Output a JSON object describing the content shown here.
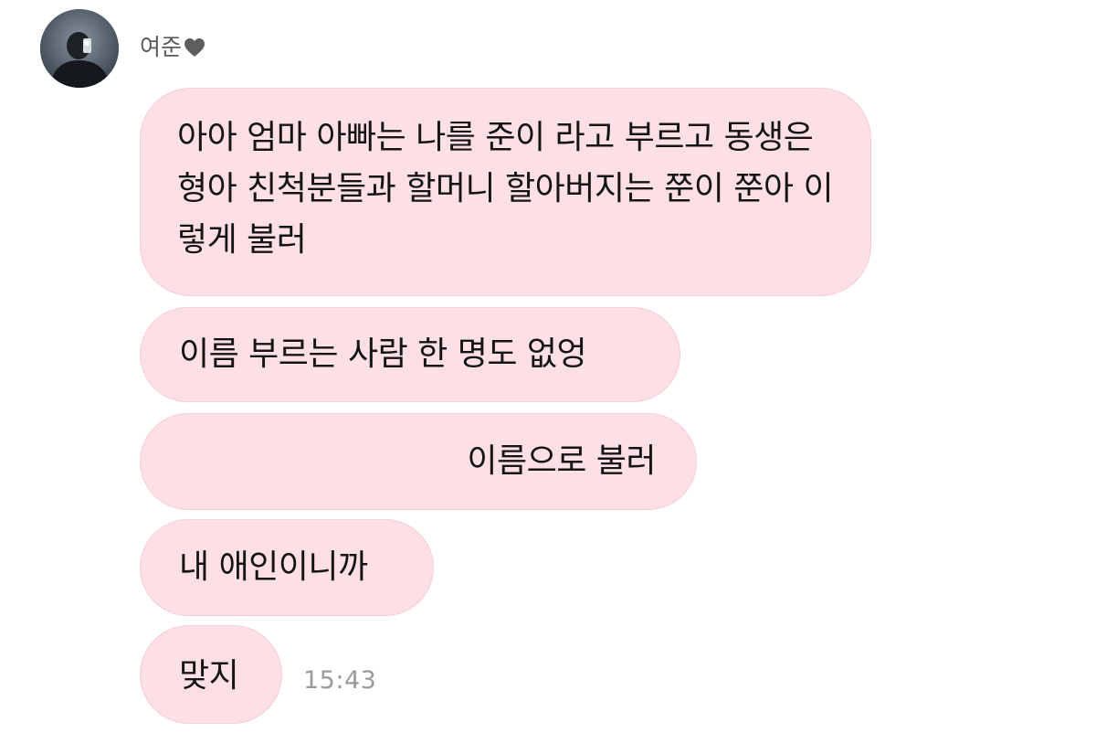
{
  "chat": {
    "sender_name": "여준",
    "sender_icon": "heart-icon",
    "bubble_color": "#fde0e5",
    "messages": [
      "아아 엄마 아빠는 나를 준이 라고 부르고 동생은 형아 친척분들과 할머니 할아버지는 쭌이 쭌아 이렇게 불러",
      "이름 부르는 사람 한 명도 없엉",
      "이름으로 불러",
      "내 애인이니까",
      "맞지"
    ],
    "timestamp": "15:43"
  }
}
